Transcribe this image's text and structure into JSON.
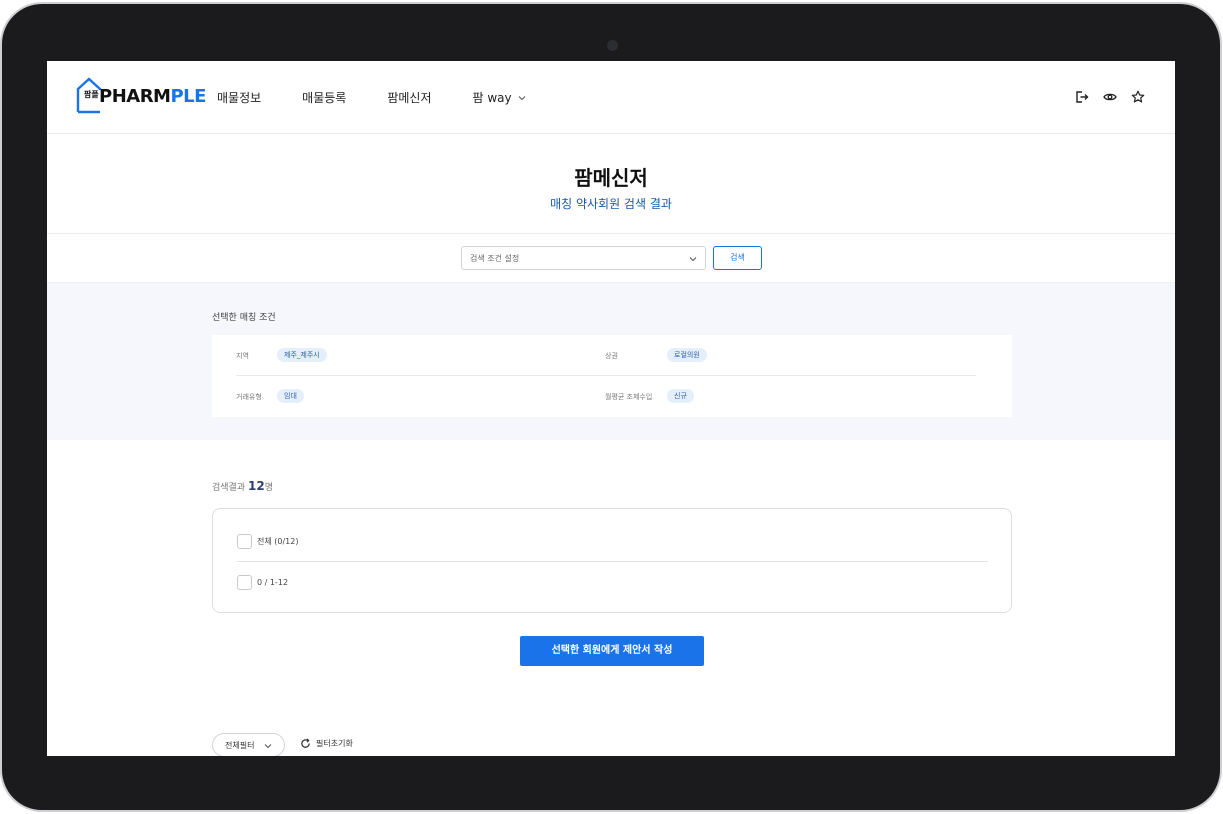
{
  "header": {
    "logo": {
      "kr_mark": "팜플",
      "brand_a": "PHARM",
      "brand_b": "PLE"
    },
    "nav": [
      {
        "label": "매물정보"
      },
      {
        "label": "매물등록"
      },
      {
        "label": "팜메신저"
      },
      {
        "label": "팜 way",
        "has_dropdown": true
      }
    ],
    "icons": [
      "logout-icon",
      "eye-icon",
      "star-icon"
    ]
  },
  "page": {
    "title": "팜메신저",
    "subtitle": "매칭 약사회원 검색 결과"
  },
  "search": {
    "select_value": "검색 조건 설정",
    "button_label": "검색"
  },
  "conditions": {
    "label": "선택한 매칭 조건",
    "rows": [
      {
        "key": "지역",
        "value": "제주_제주시",
        "key2": "상권",
        "value2": "로컬의원"
      },
      {
        "key": "거래유형",
        "value": "임대",
        "key2": "월평균 조제수입",
        "value2": "신규"
      }
    ]
  },
  "results": {
    "label": "검색결과",
    "count": "12",
    "unit": "명",
    "all_label": "전체 (0/12)",
    "range_label": "0 / 1-12"
  },
  "cta_label": "선택한 회원에게 제안서 작성",
  "filters": {
    "all_filter_label": "전체필터",
    "reset_label": "필터초기화"
  },
  "colors": {
    "accent": "#1a73e8",
    "chip_bg": "#e5effb",
    "subtitle": "#1559a8"
  }
}
